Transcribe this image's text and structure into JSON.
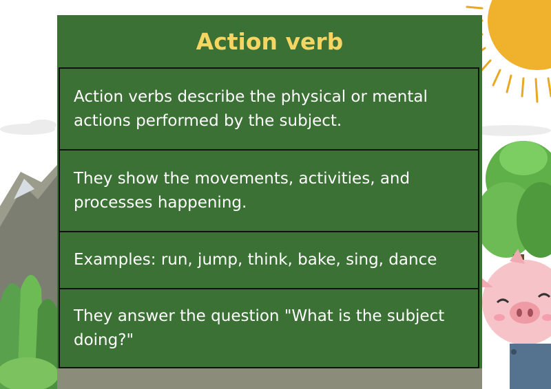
{
  "card": {
    "title": "Action verb",
    "rows": [
      "Action verbs describe the physical or mental actions performed by the subject.",
      "They show the movements, activities, and processes happening.",
      "Examples: run, jump, think, bake, sing, dance",
      "They answer the question \"What is the subject doing?\""
    ]
  },
  "colors": {
    "card_background": "#3b7134",
    "title_text": "#f6d562",
    "body_text": "#ffffff",
    "row_border": "#111111"
  }
}
